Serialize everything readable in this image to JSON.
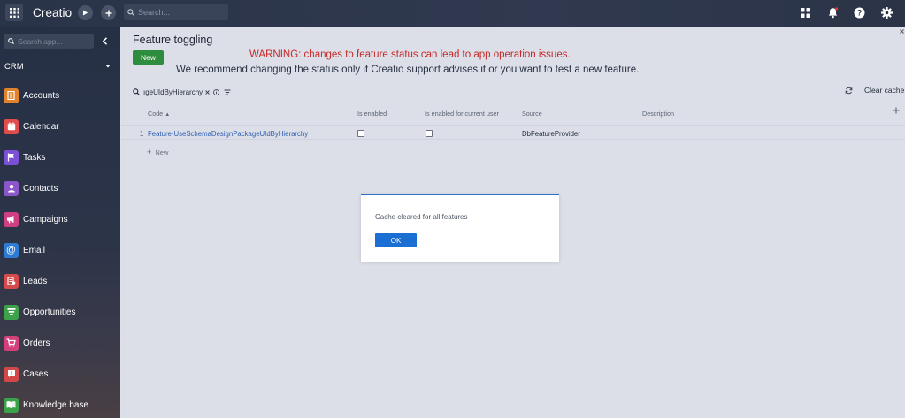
{
  "topbar": {
    "logo": "Creatio",
    "search_placeholder": "Search..."
  },
  "sidebar": {
    "search_placeholder": "Search app...",
    "workspace": "CRM",
    "items": [
      {
        "label": "Accounts",
        "color": "#e0832c"
      },
      {
        "label": "Calendar",
        "color": "#e04b4b"
      },
      {
        "label": "Tasks",
        "color": "#7b4fd6"
      },
      {
        "label": "Contacts",
        "color": "#8a56c9"
      },
      {
        "label": "Campaigns",
        "color": "#cf3f82"
      },
      {
        "label": "Email",
        "color": "#2e7bd4"
      },
      {
        "label": "Leads",
        "color": "#d54a4a"
      },
      {
        "label": "Opportunities",
        "color": "#3ba24a"
      },
      {
        "label": "Orders",
        "color": "#d23f7a"
      },
      {
        "label": "Cases",
        "color": "#d24848"
      },
      {
        "label": "Knowledge base",
        "color": "#3ba24a"
      }
    ]
  },
  "main": {
    "title": "Feature toggling",
    "new_button": "New",
    "warning": "WARNING: changes to feature status can lead to app operation issues.",
    "recommendation": "We recommend changing the status only if Creatio support advises it or you want to test a new feature.",
    "filter_text": "ıgeUIdByHierarchy",
    "clear_cache": "Clear cache",
    "columns": {
      "code": "Code",
      "is_enabled": "Is enabled",
      "is_enabled_user": "Is enabled for current user",
      "source": "Source",
      "description": "Description"
    },
    "row": {
      "index": "1",
      "code": "Feature-UseSchemaDesignPackageUIdByHierarchy",
      "source": "DbFeatureProvider"
    },
    "add_row": "New"
  },
  "dialog": {
    "message": "Cache cleared for all features",
    "ok": "OK"
  }
}
